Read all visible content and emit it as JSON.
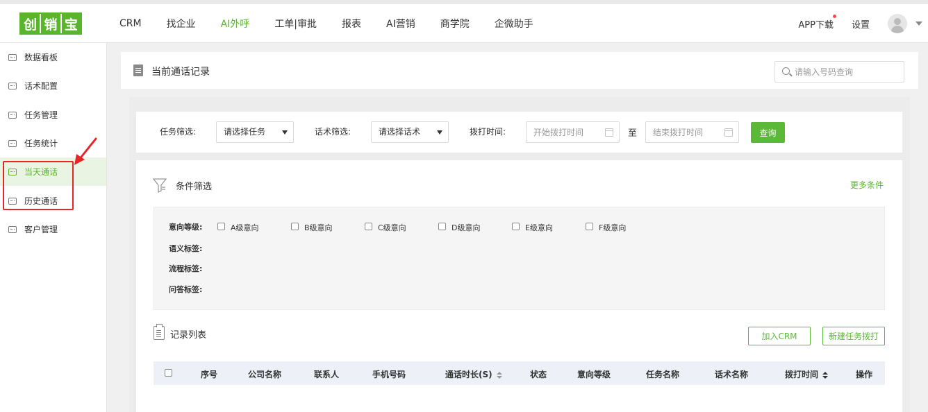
{
  "logo": {
    "chars": [
      "创",
      "销",
      "宝"
    ]
  },
  "nav": {
    "items": [
      {
        "label": "CRM",
        "active": false
      },
      {
        "label": "找企业",
        "active": false
      },
      {
        "label": "AI外呼",
        "active": true
      },
      {
        "label": "工单|审批",
        "active": false
      },
      {
        "label": "报表",
        "active": false
      },
      {
        "label": "AI营销",
        "active": false
      },
      {
        "label": "商学院",
        "active": false
      },
      {
        "label": "企微助手",
        "active": false
      }
    ],
    "app_download": "APP下载",
    "settings": "设置"
  },
  "sidebar": {
    "items": [
      {
        "label": "数据看板"
      },
      {
        "label": "话术配置"
      },
      {
        "label": "任务管理"
      },
      {
        "label": "任务统计"
      },
      {
        "label": "当天通话",
        "active": true
      },
      {
        "label": "历史通话"
      },
      {
        "label": "客户管理"
      }
    ]
  },
  "header": {
    "title": "当前通话记录",
    "search_placeholder": "请输入号码查询"
  },
  "filters": {
    "task_label": "任务筛选:",
    "task_value": "请选择任务",
    "script_label": "话术筛选:",
    "script_value": "请选择话术",
    "time_label": "拨打时间:",
    "start_placeholder": "开始拨打时间",
    "to": "至",
    "end_placeholder": "结束拨打时间",
    "query_button": "查询"
  },
  "conditions": {
    "title": "条件筛选",
    "more": "更多条件",
    "intent_label": "意向等级:",
    "intent_options": [
      "A级意向",
      "B级意向",
      "C级意向",
      "D级意向",
      "E级意向",
      "F级意向"
    ],
    "semantic_label": "语义标签:",
    "flow_label": "流程标签:",
    "qa_label": "问答标签:"
  },
  "records": {
    "title": "记录列表",
    "add_crm_button": "加入CRM",
    "new_task_button": "新建任务拨打",
    "columns": [
      "序号",
      "公司名称",
      "联系人",
      "手机号码",
      "通话时长(S)",
      "状态",
      "意向等级",
      "任务名称",
      "话术名称",
      "拨打时间",
      "操作"
    ]
  },
  "colors": {
    "accent": "#58b52c",
    "annotation": "#e8242a"
  }
}
